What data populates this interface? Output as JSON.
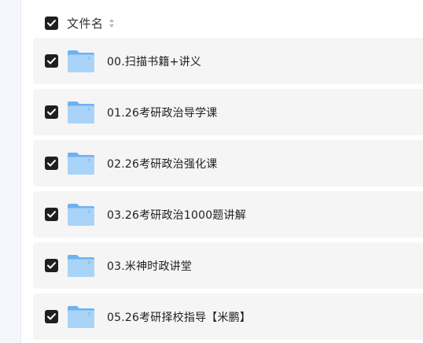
{
  "header": {
    "column_label": "文件名"
  },
  "files": [
    {
      "name": "00.扫描书籍+讲义",
      "checked": true,
      "icon": "folder-icon"
    },
    {
      "name": "01.26考研政治导学课",
      "checked": true,
      "icon": "folder-icon"
    },
    {
      "name": "02.26考研政治强化课",
      "checked": true,
      "icon": "folder-icon"
    },
    {
      "name": "03.26考研政治1000题讲解",
      "checked": true,
      "icon": "folder-icon"
    },
    {
      "name": "03.米神时政讲堂",
      "checked": true,
      "icon": "folder-icon"
    },
    {
      "name": "05.26考研择校指导【米鹏】",
      "checked": true,
      "icon": "folder-icon"
    }
  ],
  "colors": {
    "checkbox": "#1f1f1f",
    "row_background": "#f5f5f6",
    "folder_light": "#a9d4f7",
    "folder_dark": "#6fb2ef"
  }
}
